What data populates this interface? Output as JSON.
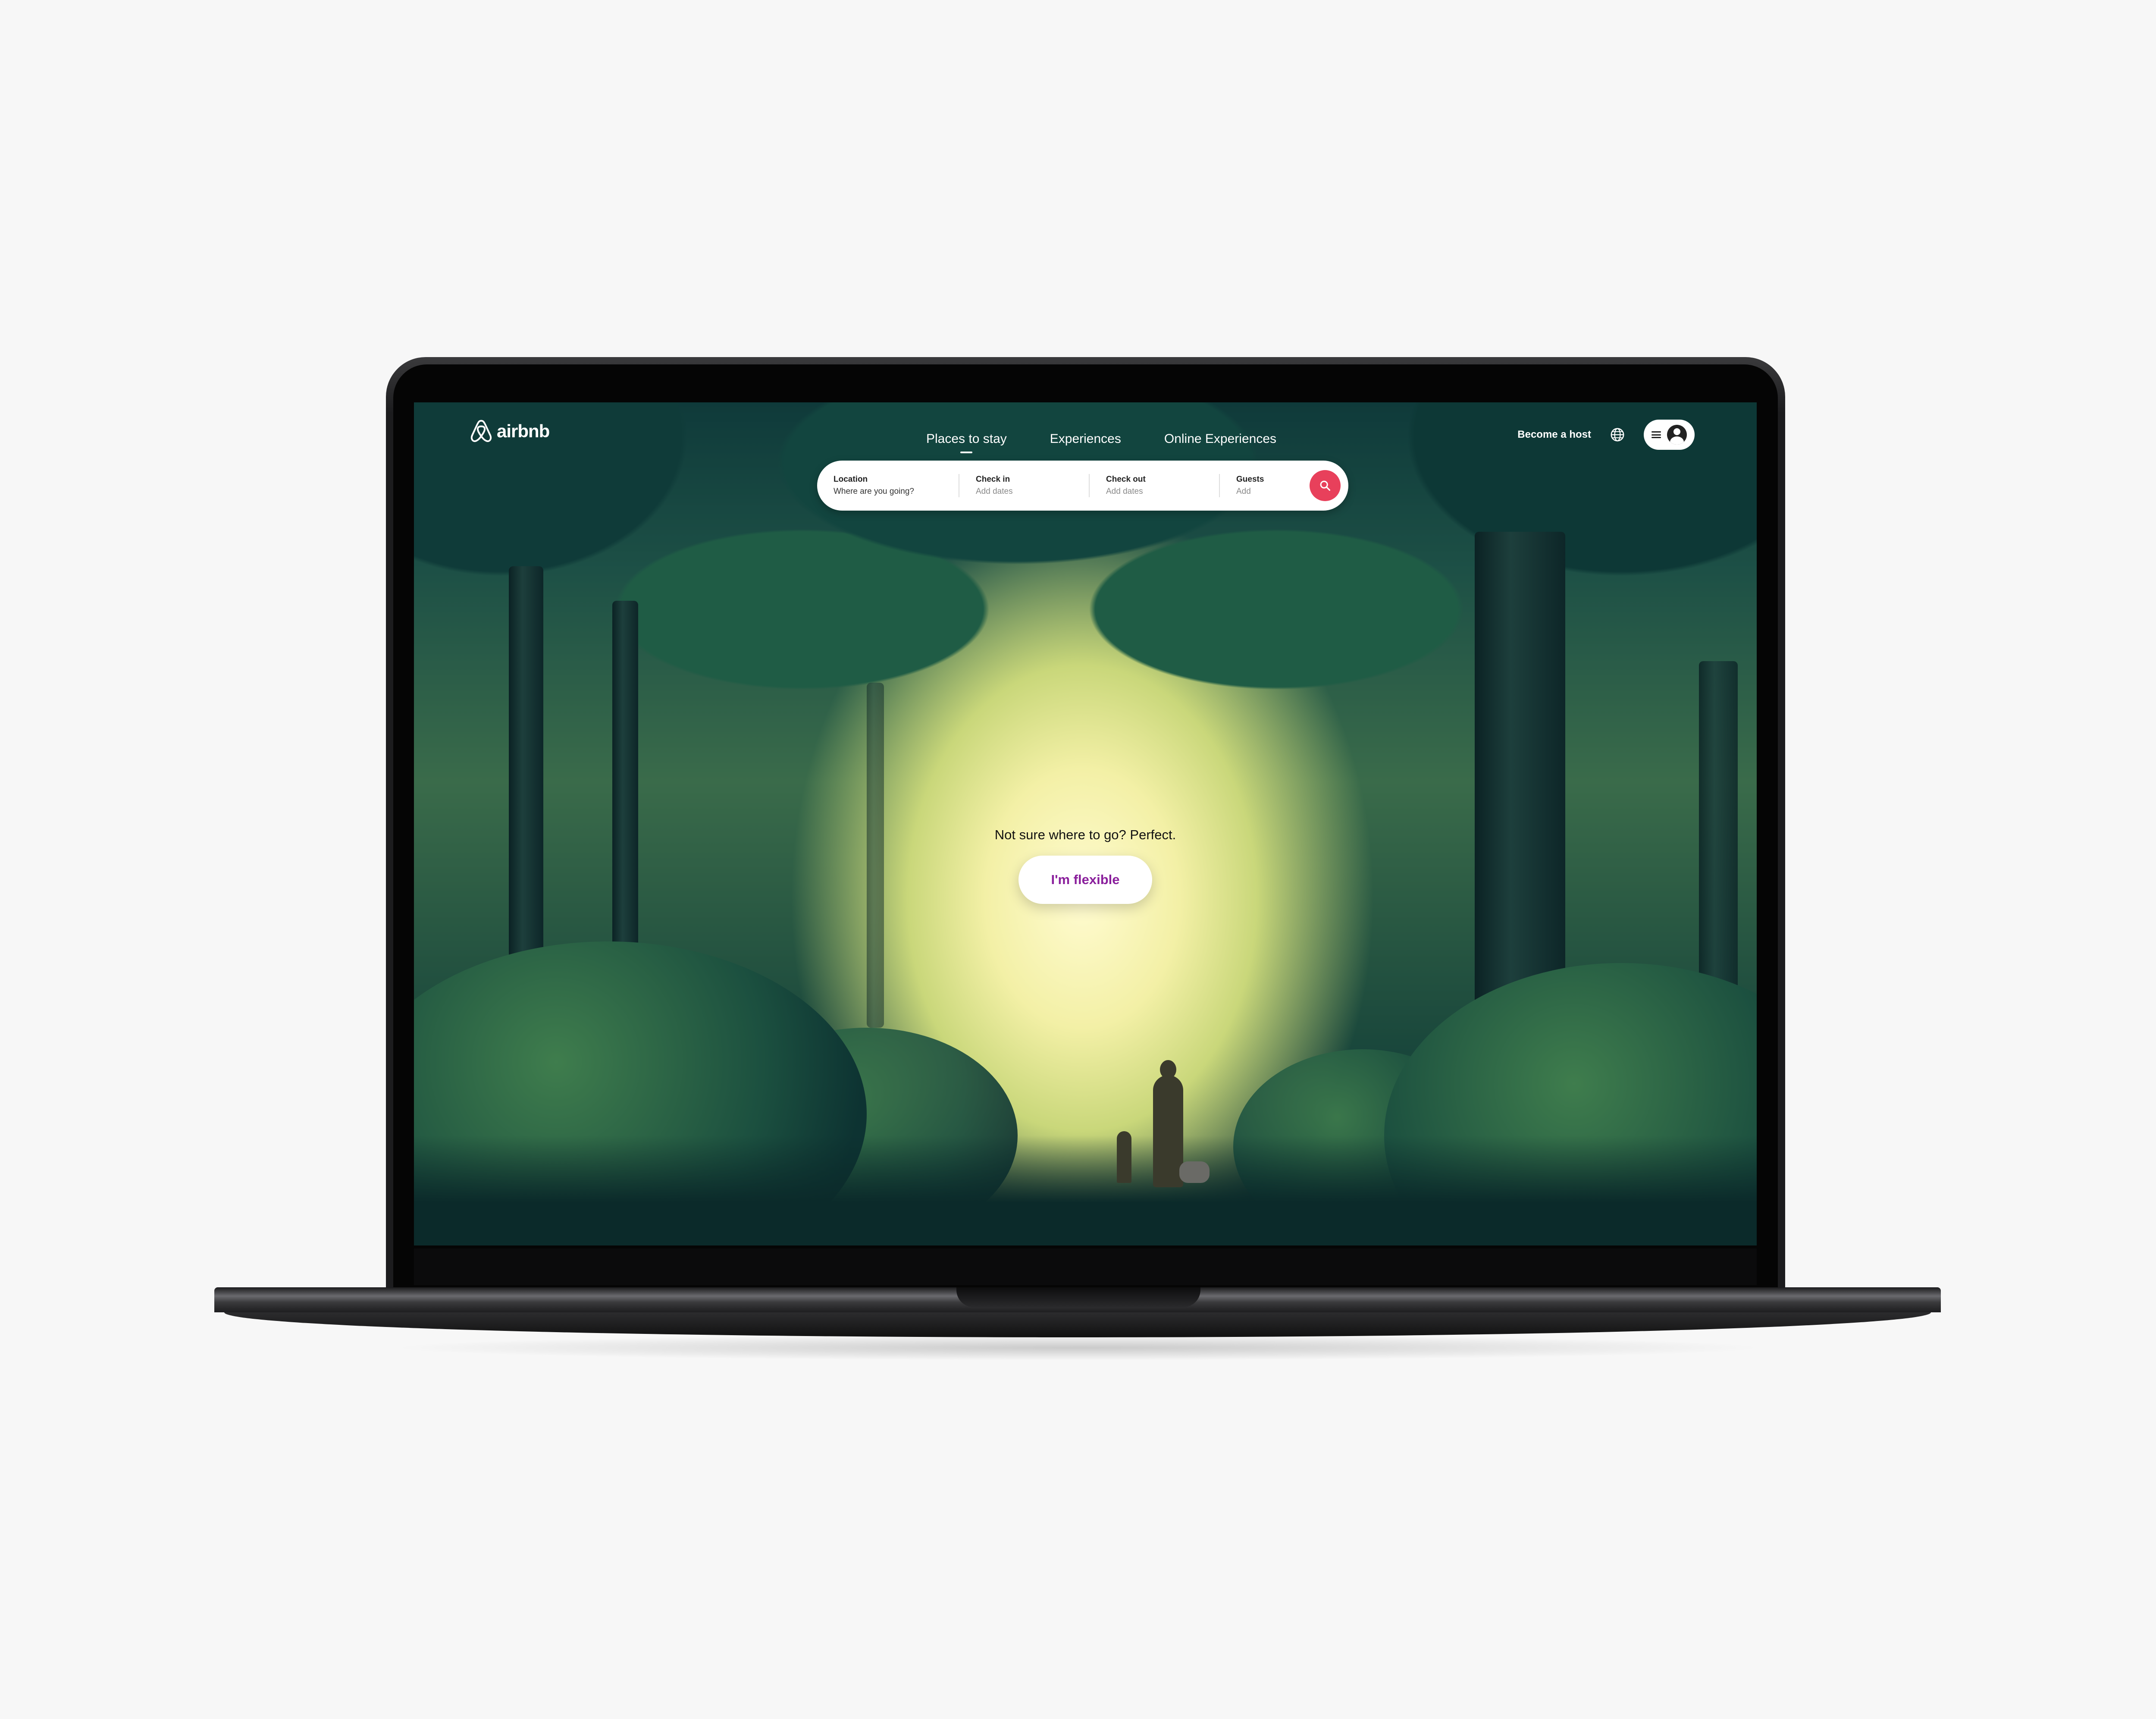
{
  "brand": {
    "name": "airbnb",
    "color": "#FF385C"
  },
  "nav": {
    "tabs": [
      {
        "label": "Places to stay",
        "active": true
      },
      {
        "label": "Experiences",
        "active": false
      },
      {
        "label": "Online Experiences",
        "active": false
      }
    ],
    "become_host": "Become a host",
    "icons": {
      "language": "globe-icon",
      "menu": "hamburger-menu-icon",
      "profile": "user-avatar-icon"
    }
  },
  "search": {
    "location": {
      "label": "Location",
      "placeholder": "Where are you going?"
    },
    "check_in": {
      "label": "Check in",
      "placeholder": "Add dates"
    },
    "check_out": {
      "label": "Check out",
      "placeholder": "Add dates"
    },
    "guests": {
      "label": "Guests",
      "placeholder": "Add"
    },
    "button_icon": "search-icon",
    "button_color": "#E8405B"
  },
  "hero": {
    "prompt": "Not sure where to go? Perfect.",
    "button_label": "I'm flexible",
    "button_text_color": "#8A1F9C"
  }
}
